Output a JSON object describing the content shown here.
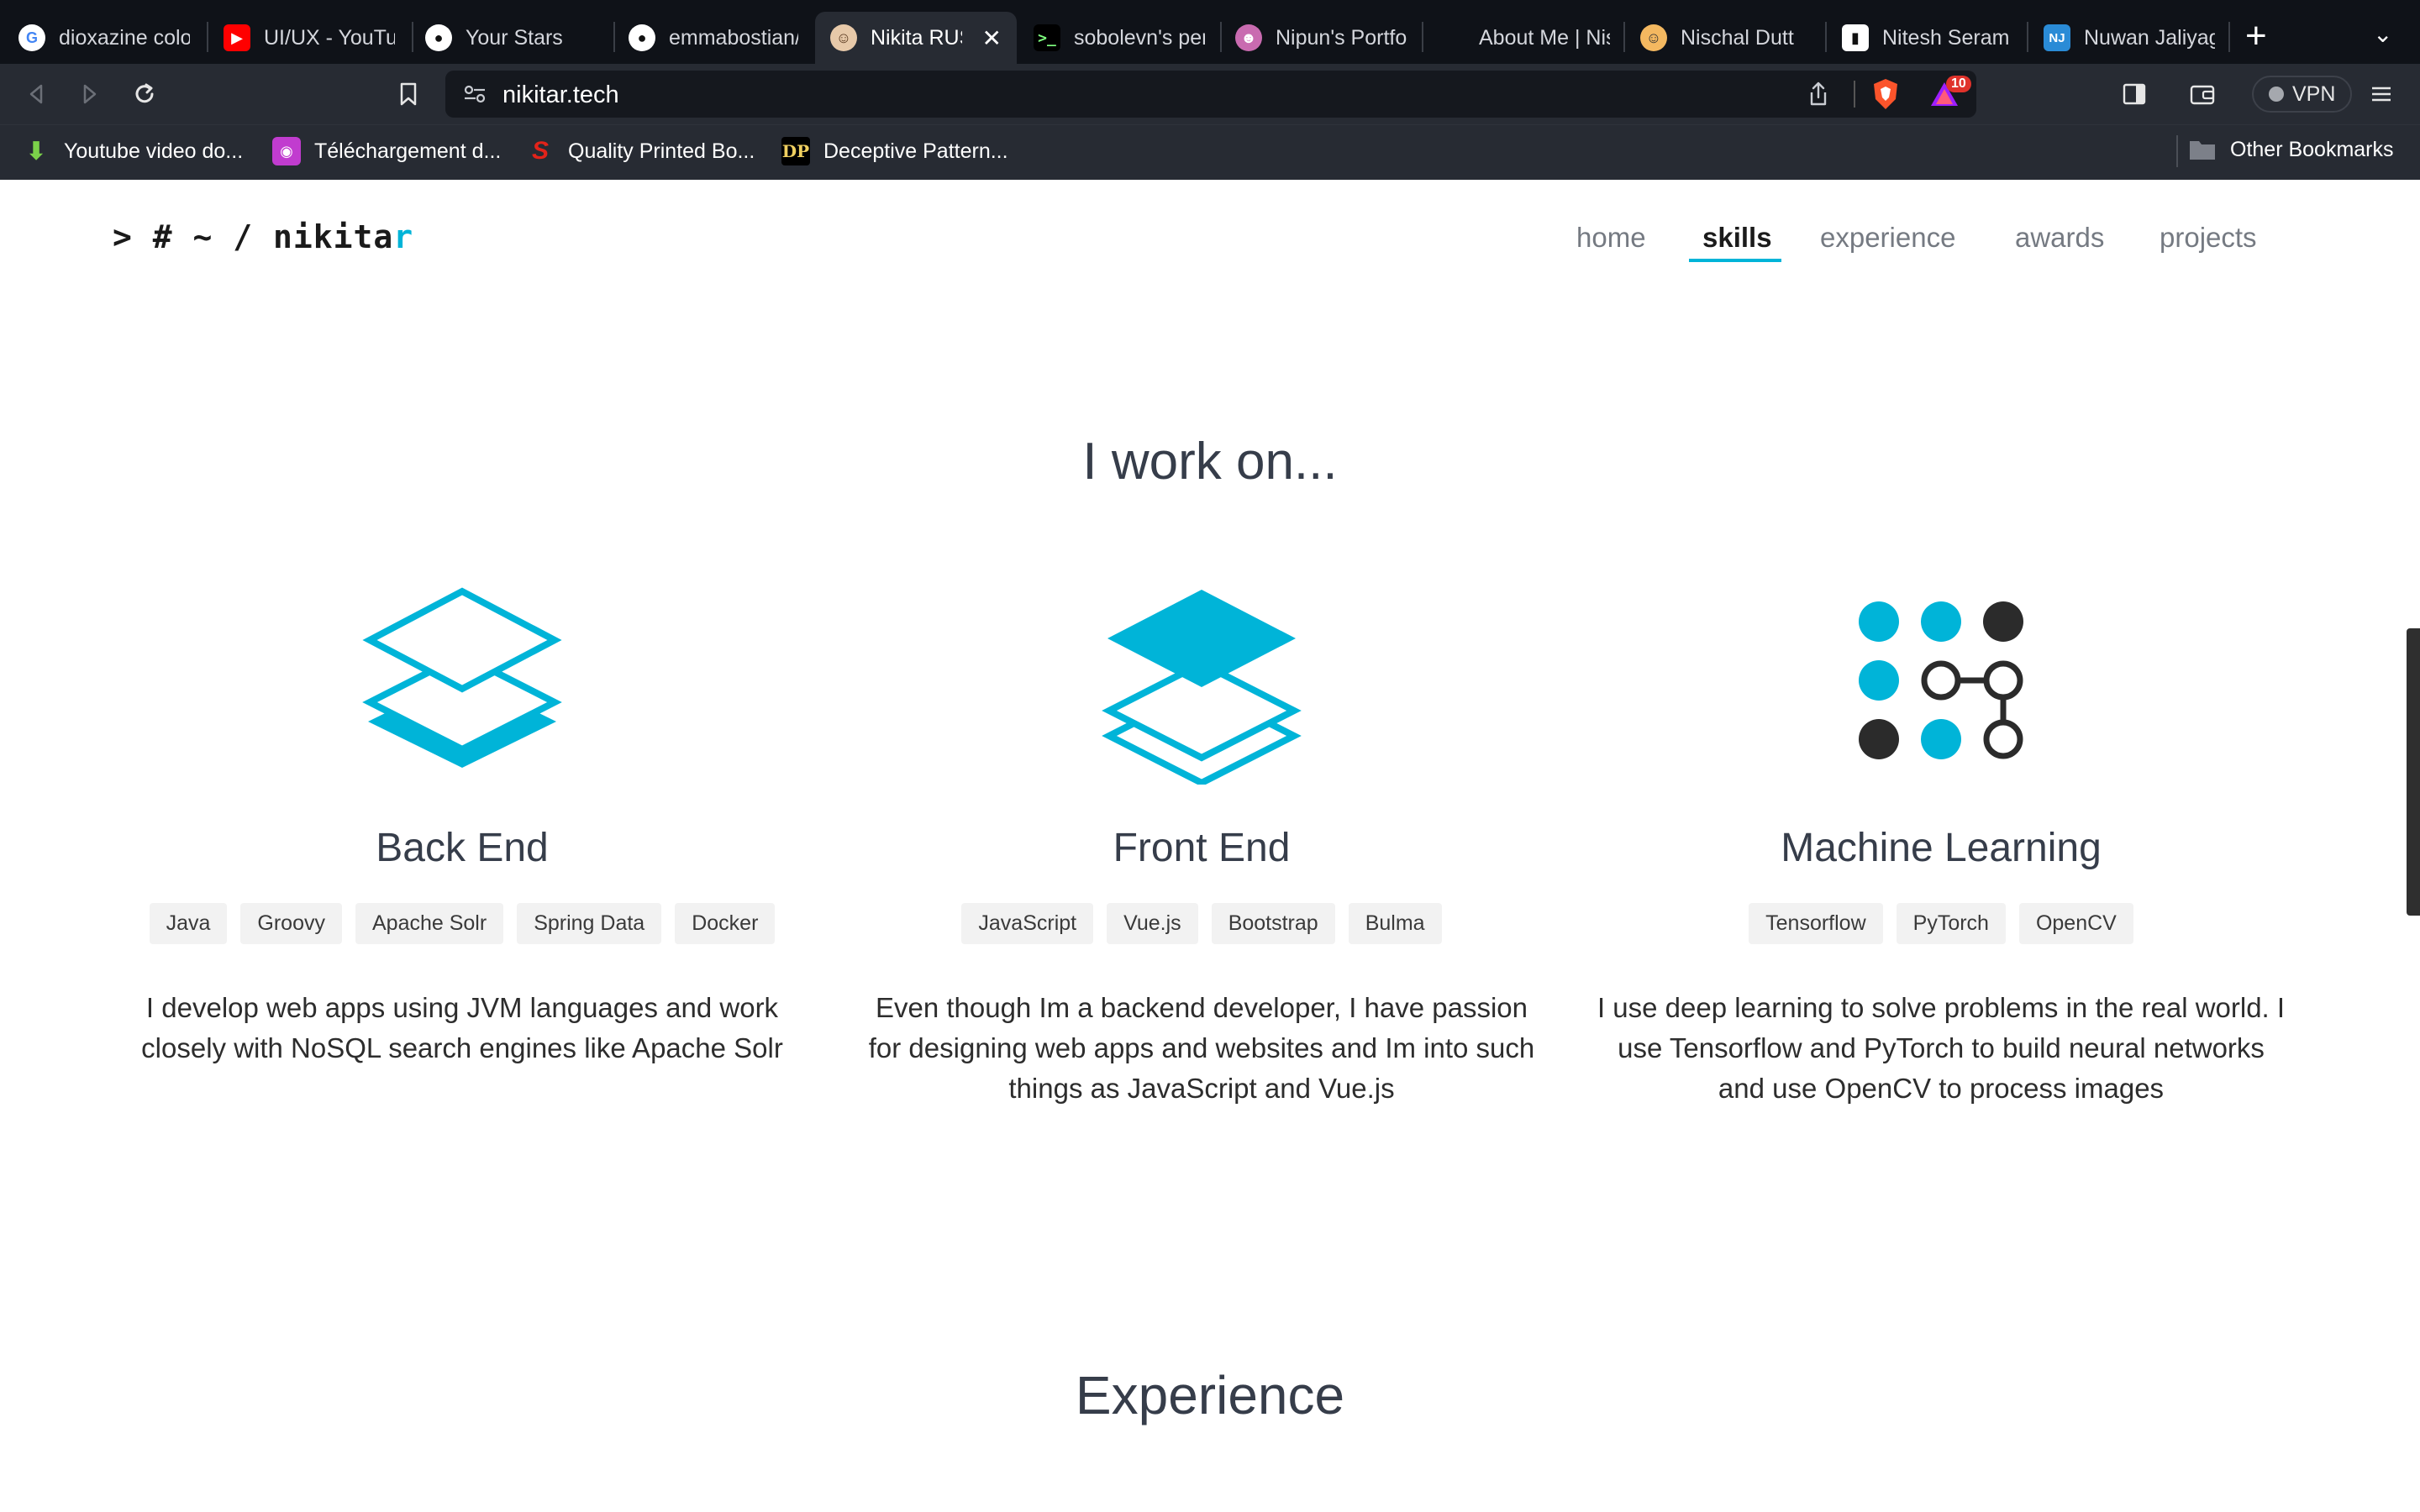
{
  "browser": {
    "tabs": [
      {
        "title": "dioxazine color",
        "icon": "google-icon"
      },
      {
        "title": "UI/UX - YouTub",
        "icon": "youtube-icon"
      },
      {
        "title": "Your Stars",
        "icon": "github-icon"
      },
      {
        "title": "emmabostian/d",
        "icon": "github-icon"
      },
      {
        "title": "Nikita RUS",
        "icon": "avatar-icon",
        "active": true
      },
      {
        "title": "sobolevn's per",
        "icon": "terminal-icon"
      },
      {
        "title": "Nipun's Portfol",
        "icon": "avatar-icon"
      },
      {
        "title": "About Me | Nis",
        "icon": "blank-icon"
      },
      {
        "title": "Nischal Dutt",
        "icon": "avatar-icon"
      },
      {
        "title": "Nitesh Seram",
        "icon": "book-icon"
      },
      {
        "title": "Nuwan Jaliyag",
        "icon": "nj-icon"
      }
    ],
    "url": "nikitar.tech",
    "brave_badge": "10",
    "vpn_label": "VPN",
    "bookmarks": [
      {
        "label": "Youtube video do...",
        "icon": "download-icon"
      },
      {
        "label": "Téléchargement d...",
        "icon": "app-icon"
      },
      {
        "label": "Quality Printed Bo...",
        "icon": "s-icon"
      },
      {
        "label": "Deceptive Pattern...",
        "icon": "dp-icon"
      }
    ],
    "other_bookmarks": "Other Bookmarks"
  },
  "site": {
    "logo_prefix": "> # ~ / nikita",
    "logo_cursor": "r",
    "nav": [
      {
        "label": "home"
      },
      {
        "label": "skills",
        "active": true
      },
      {
        "label": "experience"
      },
      {
        "label": "awards"
      },
      {
        "label": "projects"
      }
    ],
    "skills_heading": "I work on...",
    "columns": [
      {
        "title": "Back End",
        "icon": "layers-bottom-icon",
        "tags": [
          "Java",
          "Groovy",
          "Apache Solr",
          "Spring Data",
          "Docker"
        ],
        "description": "I develop web apps using JVM languages and work closely with NoSQL search engines like Apache Solr"
      },
      {
        "title": "Front End",
        "icon": "layers-top-icon",
        "tags": [
          "JavaScript",
          "Vue.js",
          "Bootstrap",
          "Bulma"
        ],
        "description": "Even though Im a backend developer, I have passion for designing web apps and websites and Im into such things as JavaScript and Vue.js"
      },
      {
        "title": "Machine Learning",
        "icon": "neural-grid-icon",
        "tags": [
          "Tensorflow",
          "PyTorch",
          "OpenCV"
        ],
        "description": "I use deep learning to solve problems in the real world. I use Tensorflow and PyTorch to build neural networks and use OpenCV to process images"
      }
    ],
    "experience_heading": "Experience"
  },
  "colors": {
    "accent": "#00b4d8",
    "dark": "#2b2b2b",
    "heading": "#363d4a"
  }
}
